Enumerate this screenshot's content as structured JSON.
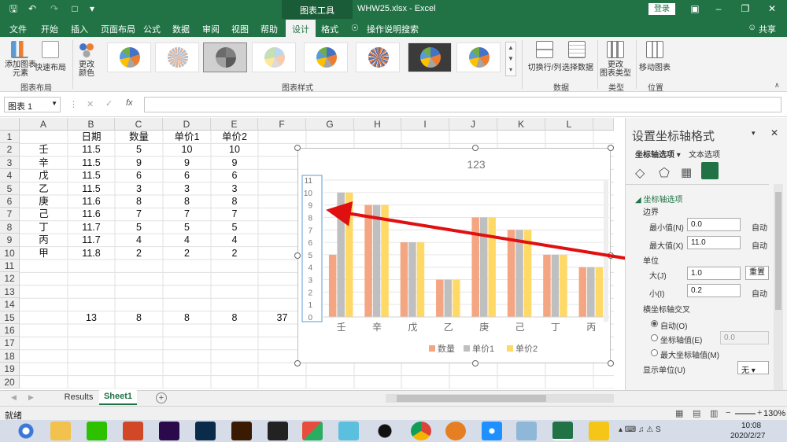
{
  "titlebar": {
    "chart_tools": "图表工具",
    "filename": "WHW25.xlsx  -  Excel",
    "login": "登录"
  },
  "tabs": [
    "文件",
    "开始",
    "插入",
    "页面布局",
    "公式",
    "数据",
    "审阅",
    "视图",
    "帮助",
    "设计",
    "格式"
  ],
  "active_tab": "设计",
  "tell_me": "操作说明搜索",
  "share": "共享",
  "ribbon": {
    "add_element": "添加图表\n元素",
    "quick_layout": "快速布局",
    "change_colors": "更改\n颜色",
    "switch_row_col": "切换行/列",
    "select_data": "选择数据",
    "change_type": "更改\n图表类型",
    "move_chart": "移动图表",
    "group_layouts": "图表布局",
    "group_styles": "图表样式",
    "group_data": "数据",
    "group_type": "类型",
    "group_location": "位置"
  },
  "namebox": "图表 1",
  "fx": "fx",
  "columns": [
    "A",
    "B",
    "C",
    "D",
    "E",
    "F",
    "G",
    "H",
    "I",
    "J",
    "K",
    "L"
  ],
  "rows": [
    "1",
    "2",
    "3",
    "4",
    "5",
    "6",
    "7",
    "8",
    "9",
    "10",
    "11",
    "12",
    "13",
    "14",
    "15",
    "16",
    "17",
    "18",
    "19",
    "20"
  ],
  "sheet": {
    "headers": [
      "日期",
      "数量",
      "单价1",
      "单价2"
    ],
    "data": [
      [
        "壬",
        "11.5",
        "5",
        "10",
        "10"
      ],
      [
        "辛",
        "11.5",
        "9",
        "9",
        "9"
      ],
      [
        "戊",
        "11.5",
        "6",
        "6",
        "6"
      ],
      [
        "乙",
        "11.5",
        "3",
        "3",
        "3"
      ],
      [
        "庚",
        "11.6",
        "8",
        "8",
        "8"
      ],
      [
        "己",
        "11.6",
        "7",
        "7",
        "7"
      ],
      [
        "丁",
        "11.7",
        "5",
        "5",
        "5"
      ],
      [
        "丙",
        "11.7",
        "4",
        "4",
        "4"
      ],
      [
        "甲",
        "11.8",
        "2",
        "2",
        "2"
      ]
    ],
    "row15": [
      "13",
      "8",
      "8",
      "8",
      "37"
    ]
  },
  "chart_data": {
    "type": "bar",
    "title": "123",
    "categories": [
      "壬",
      "辛",
      "戊",
      "乙",
      "庚",
      "己",
      "丁",
      "丙"
    ],
    "series": [
      {
        "name": "数量",
        "values": [
          5,
          9,
          6,
          3,
          8,
          7,
          5,
          4
        ],
        "color": "#f4a582"
      },
      {
        "name": "单价1",
        "values": [
          10,
          9,
          6,
          3,
          8,
          7,
          5,
          4
        ],
        "color": "#bfbfbf"
      },
      {
        "name": "单价2",
        "values": [
          10,
          9,
          6,
          3,
          8,
          7,
          5,
          4
        ],
        "color": "#ffd966"
      }
    ],
    "ylim": [
      0,
      11
    ],
    "yticks": [
      "0",
      "1",
      "2",
      "3",
      "4",
      "5",
      "6",
      "7",
      "8",
      "9",
      "10",
      "11"
    ],
    "legend": "bottom",
    "grid": true
  },
  "pane": {
    "title": "设置坐标轴格式",
    "tab_axis": "坐标轴选项",
    "tab_text": "文本选项",
    "section": "坐标轴选项",
    "bounds": "边界",
    "min_label": "最小值(N)",
    "min_value": "0.0",
    "max_label": "最大值(X)",
    "max_value": "11.0",
    "auto": "自动",
    "units": "单位",
    "major_label": "大(J)",
    "major_value": "1.0",
    "reset": "重置",
    "minor_label": "小(I)",
    "minor_value": "0.2",
    "cross": "横坐标轴交叉",
    "cross_auto": "自动(O)",
    "cross_value": "坐标轴值(E)",
    "cross_value_num": "0.0",
    "cross_max": "最大坐标轴值(M)",
    "display_units": "显示单位(U)",
    "display_units_value": "无"
  },
  "sheet_tabs": [
    "Results",
    "Sheet1"
  ],
  "active_sheet": "Sheet1",
  "status": {
    "ready": "就绪",
    "zoom": "130%"
  },
  "clock": {
    "time": "10:08",
    "date": "2020/2/27"
  },
  "colors": {
    "excel_green": "#217346",
    "arrow": "#e01010"
  }
}
